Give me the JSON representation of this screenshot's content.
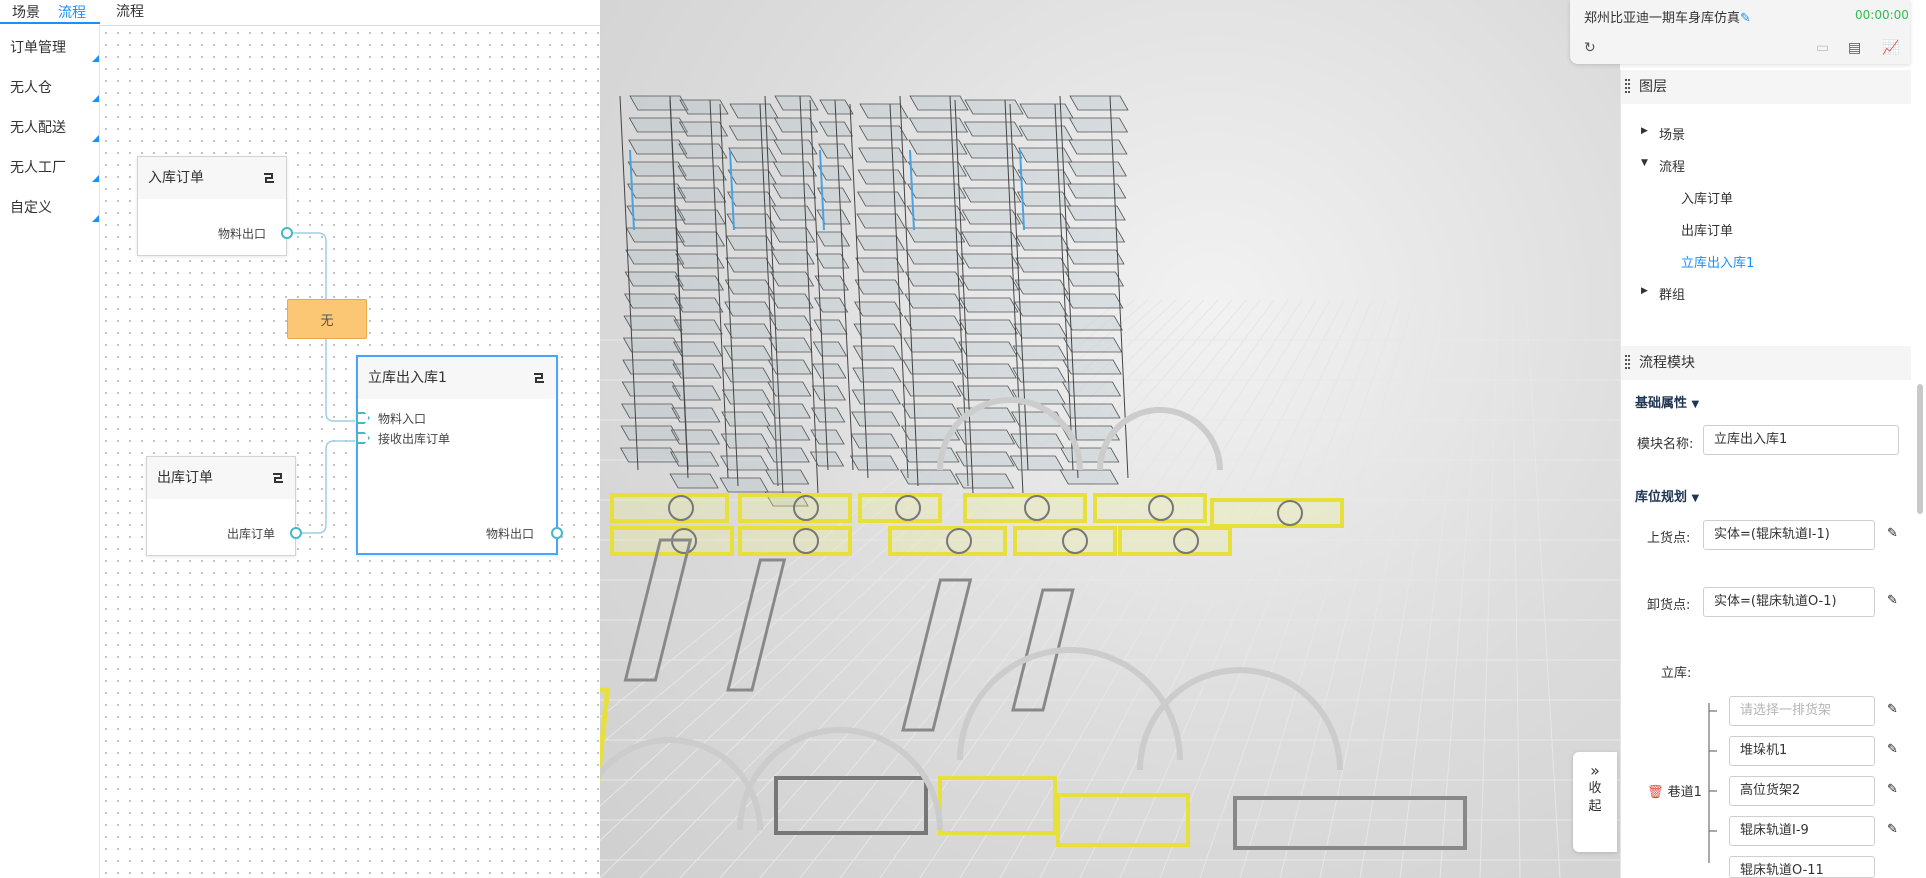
{
  "top_tabs": [
    {
      "label": "场景"
    },
    {
      "label": "流程"
    }
  ],
  "canvas_header": "流程",
  "left_nav": [
    {
      "label": "订单管理"
    },
    {
      "label": "无人仓"
    },
    {
      "label": "无人配送"
    },
    {
      "label": "无人工厂"
    },
    {
      "label": "自定义"
    }
  ],
  "nodes": {
    "inbound": {
      "title": "入库订单",
      "out_port": "物料出口"
    },
    "outbound": {
      "title": "出库订单",
      "out_port": "出库订单"
    },
    "warehouse": {
      "title": "立库出入库1",
      "in_port_1": "物料入口",
      "in_port_2": "接收出库订单",
      "out_port": "物料出口"
    },
    "none_label": "无"
  },
  "info": {
    "title": "郑州比亚迪一期车身库仿真",
    "time": "00:00:00",
    "icons": [
      "refresh-icon",
      "video-icon",
      "table-icon",
      "chart-icon"
    ]
  },
  "layers": {
    "title": "图层",
    "items": [
      {
        "label": "场景"
      },
      {
        "label": "流程"
      },
      {
        "label": "入库订单"
      },
      {
        "label": "出库订单"
      },
      {
        "label": "立库出入库1"
      },
      {
        "label": "群组"
      }
    ]
  },
  "module": {
    "title": "流程模块",
    "basic_title": "基础属性",
    "name_label": "模块名称:",
    "name_value": "立库出入库1",
    "storage_title": "库位规划",
    "load_label": "上货点:",
    "load_value": "实体=(辊床轨道I-1)",
    "unload_label": "卸货点:",
    "unload_value": "实体=(辊床轨道O-1)",
    "rack_label": "立库:",
    "rack_placeholder": "请选择一排货架",
    "lane_label": "巷道1",
    "lane_items": [
      "堆垛机1",
      "高位货架2",
      "辊床轨道I-9",
      "辊床轨道O-11"
    ]
  },
  "collapse": {
    "arrow": "»",
    "line1": "收",
    "line2": "起"
  },
  "colors": {
    "accent": "#1890ff",
    "port": "#46b7c8",
    "none_box": "#fcc774",
    "rack_blue": "#4aa3e0",
    "conveyor_yellow": "#e8e03a",
    "time_green": "#2fbf4f"
  }
}
